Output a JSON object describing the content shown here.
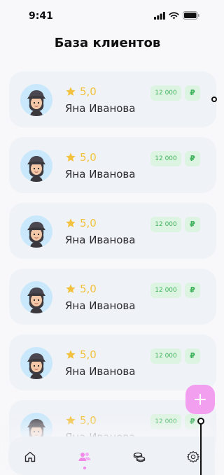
{
  "status_bar": {
    "time": "9:41"
  },
  "header": {
    "title": "База клиентов"
  },
  "clients": [
    {
      "rating": "5,0",
      "name": "Яна Иванова",
      "price": "12 000",
      "currency": "₽"
    },
    {
      "rating": "5,0",
      "name": "Яна Иванова",
      "price": "12 000",
      "currency": "₽"
    },
    {
      "rating": "5,0",
      "name": "Яна Иванова",
      "price": "12 000",
      "currency": "₽"
    },
    {
      "rating": "5,0",
      "name": "Яна Иванова",
      "price": "12 000",
      "currency": "₽"
    },
    {
      "rating": "5,0",
      "name": "Яна Иванова",
      "price": "12 000",
      "currency": "₽"
    },
    {
      "rating": "5,0",
      "name": "Яна Иванова",
      "price": "12 000",
      "currency": "₽"
    }
  ],
  "fab": {
    "icon": "plus-icon"
  },
  "bottom_nav": {
    "items": [
      {
        "icon": "home-icon",
        "active": false
      },
      {
        "icon": "clients-icon",
        "active": true
      },
      {
        "icon": "coins-icon",
        "active": false
      },
      {
        "icon": "gear-icon",
        "active": false
      }
    ]
  },
  "colors": {
    "accent": "#f39ff0",
    "star": "#f2c13d",
    "price_text": "#3fb25b",
    "price_bg": "#def4e2",
    "card_bg": "#eff2f7"
  }
}
